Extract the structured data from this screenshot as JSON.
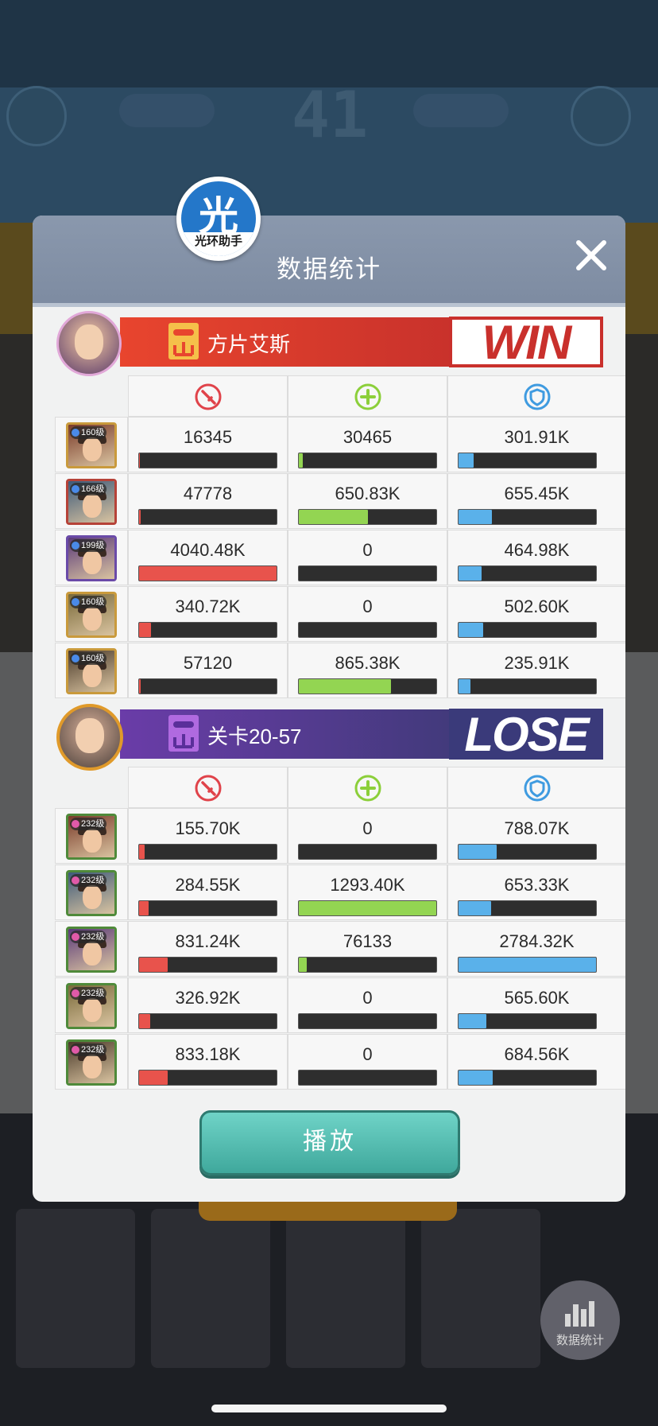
{
  "modal": {
    "title": "数据统计",
    "logo_char": "光",
    "logo_sub": "光环助手",
    "play_label": "播放"
  },
  "background": {
    "round_number": "41",
    "fab_label": "数据统计"
  },
  "teams": [
    {
      "name": "方片艾斯",
      "result": "WIN",
      "rows": [
        {
          "level": "160级",
          "rarity": "gold",
          "damage": "16345",
          "damage_pct": 0.004,
          "heal": "30465",
          "heal_pct": 0.03,
          "tank": "301.91K",
          "tank_pct": 0.11
        },
        {
          "level": "166级",
          "rarity": "red",
          "damage": "47778",
          "damage_pct": 0.012,
          "heal": "650.83K",
          "heal_pct": 0.5,
          "tank": "655.45K",
          "tank_pct": 0.24
        },
        {
          "level": "199级",
          "rarity": "purple",
          "damage": "4040.48K",
          "damage_pct": 1.0,
          "heal": "0",
          "heal_pct": 0,
          "tank": "464.98K",
          "tank_pct": 0.17
        },
        {
          "level": "160级",
          "rarity": "gold",
          "damage": "340.72K",
          "damage_pct": 0.084,
          "heal": "0",
          "heal_pct": 0,
          "tank": "502.60K",
          "tank_pct": 0.18
        },
        {
          "level": "160级",
          "rarity": "gold",
          "damage": "57120",
          "damage_pct": 0.014,
          "heal": "865.38K",
          "heal_pct": 0.67,
          "tank": "235.91K",
          "tank_pct": 0.085
        }
      ]
    },
    {
      "name": "关卡20-57",
      "result": "LOSE",
      "rows": [
        {
          "level": "232级",
          "rarity": "green",
          "damage": "155.70K",
          "damage_pct": 0.038,
          "heal": "0",
          "heal_pct": 0,
          "tank": "788.07K",
          "tank_pct": 0.28
        },
        {
          "level": "232级",
          "rarity": "green",
          "damage": "284.55K",
          "damage_pct": 0.07,
          "heal": "1293.40K",
          "heal_pct": 1.0,
          "tank": "653.33K",
          "tank_pct": 0.235
        },
        {
          "level": "232级",
          "rarity": "green",
          "damage": "831.24K",
          "damage_pct": 0.206,
          "heal": "76133",
          "heal_pct": 0.06,
          "tank": "2784.32K",
          "tank_pct": 1.0
        },
        {
          "level": "232级",
          "rarity": "green",
          "damage": "326.92K",
          "damage_pct": 0.081,
          "heal": "0",
          "heal_pct": 0,
          "tank": "565.60K",
          "tank_pct": 0.203
        },
        {
          "level": "232级",
          "rarity": "green",
          "damage": "833.18K",
          "damage_pct": 0.206,
          "heal": "0",
          "heal_pct": 0,
          "tank": "684.56K",
          "tank_pct": 0.246
        }
      ]
    }
  ],
  "colors": {
    "damage": "#e8534c",
    "heal": "#93d552",
    "tank": "#5ab1ea",
    "win": "#c9302c",
    "lose": "#3a3a7a",
    "play_button": "#4fbcb0"
  },
  "icons": {
    "damage": "sword-icon",
    "heal": "plus-cross-icon",
    "tank": "shield-icon",
    "close": "close-icon"
  }
}
